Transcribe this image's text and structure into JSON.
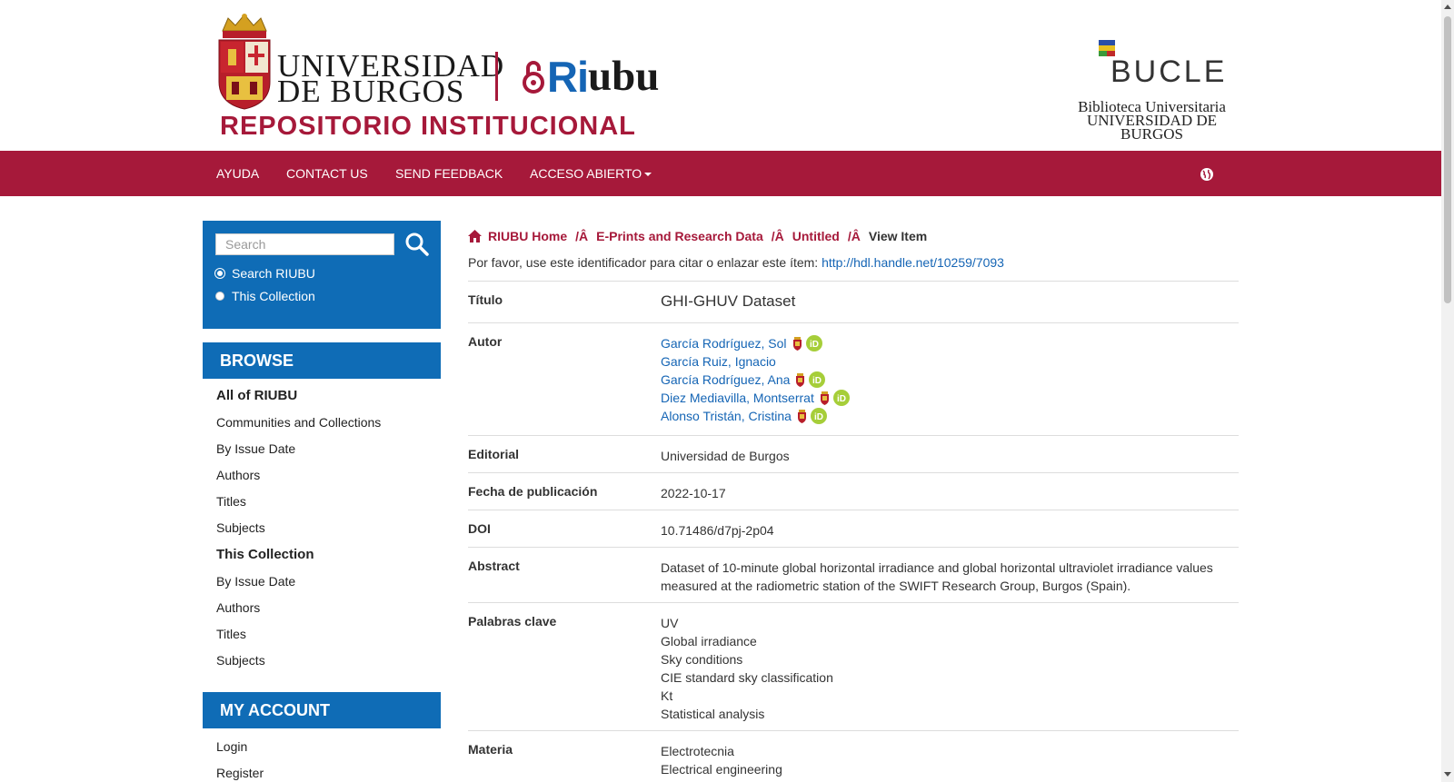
{
  "header": {
    "university_line1": "UNIVERSIDAD",
    "university_line2": "DE BURGOS",
    "riubu_ri": "Ri",
    "riubu_ubu": "ubu",
    "repository_label": "REPOSITORIO INSTITUCIONAL",
    "bucle_word": "BUCLE",
    "bucle_line1": "Biblioteca Universitaria",
    "bucle_line2": "UNIVERSIDAD DE BURGOS"
  },
  "nav": {
    "items": [
      "AYUDA",
      "CONTACT US",
      "SEND FEEDBACK",
      "ACCESO ABIERTO"
    ],
    "language_icon": "globe-icon"
  },
  "sidebar": {
    "search_placeholder": "Search",
    "search_icon": "search-icon",
    "scope_options": [
      "Search RIUBU",
      "This Collection"
    ],
    "selected_scope": "Search RIUBU",
    "browse_heading": "BROWSE",
    "all_heading": "All of RIUBU",
    "all_links": [
      "Communities and Collections",
      "By Issue Date",
      "Authors",
      "Titles",
      "Subjects"
    ],
    "collection_heading": "This Collection",
    "collection_links": [
      "By Issue Date",
      "Authors",
      "Titles",
      "Subjects"
    ],
    "account_heading": "MY ACCOUNT",
    "account_links": [
      "Login",
      "Register"
    ]
  },
  "breadcrumb": {
    "home_icon": "home-icon",
    "items": [
      "RIUBU Home",
      "E-Prints and Research Data",
      "Untitled"
    ],
    "separator": "/Â",
    "current": "View Item"
  },
  "handle": {
    "text": "Por favor, use este identificador para citar o enlazar este ítem:",
    "url": "http://hdl.handle.net/10259/7093"
  },
  "item": {
    "title_label": "Título",
    "title_value": "GHI-GHUV Dataset",
    "author_label": "Autor",
    "authors": [
      {
        "name": "García Rodríguez, Sol",
        "ubu": true,
        "orcid": true
      },
      {
        "name": "García Ruiz, Ignacio",
        "ubu": false,
        "orcid": false
      },
      {
        "name": "García Rodríguez, Ana",
        "ubu": true,
        "orcid": true
      },
      {
        "name": "Diez Mediavilla, Montserrat",
        "ubu": true,
        "orcid": true
      },
      {
        "name": "Alonso Tristán, Cristina",
        "ubu": true,
        "orcid": true
      }
    ],
    "publisher_label": "Editorial",
    "publisher_value": "Universidad de Burgos",
    "date_label": "Fecha de publicación",
    "date_value": "2022-10-17",
    "doi_label": "DOI",
    "doi_value": "10.71486/d7pj-2p04",
    "abstract_label": "Abstract",
    "abstract_line1": "Dataset of 10-minute global horizontal irradiance and global horizontal ultraviolet irradiance values",
    "abstract_line2": "measured at the radiometric station of the SWIFT Research Group, Burgos (Spain).",
    "keywords_label": "Palabras clave",
    "keywords": [
      "UV",
      "Global irradiance",
      "Sky conditions",
      "CIE standard sky classification",
      "Kt",
      "Statistical analysis"
    ],
    "subject_label": "Materia",
    "subjects": [
      "Electrotecnia",
      "Electrical engineering"
    ]
  },
  "colors": {
    "brand_red": "#a6193a",
    "brand_blue": "#0f6cb6",
    "link_blue": "#1565b5"
  }
}
